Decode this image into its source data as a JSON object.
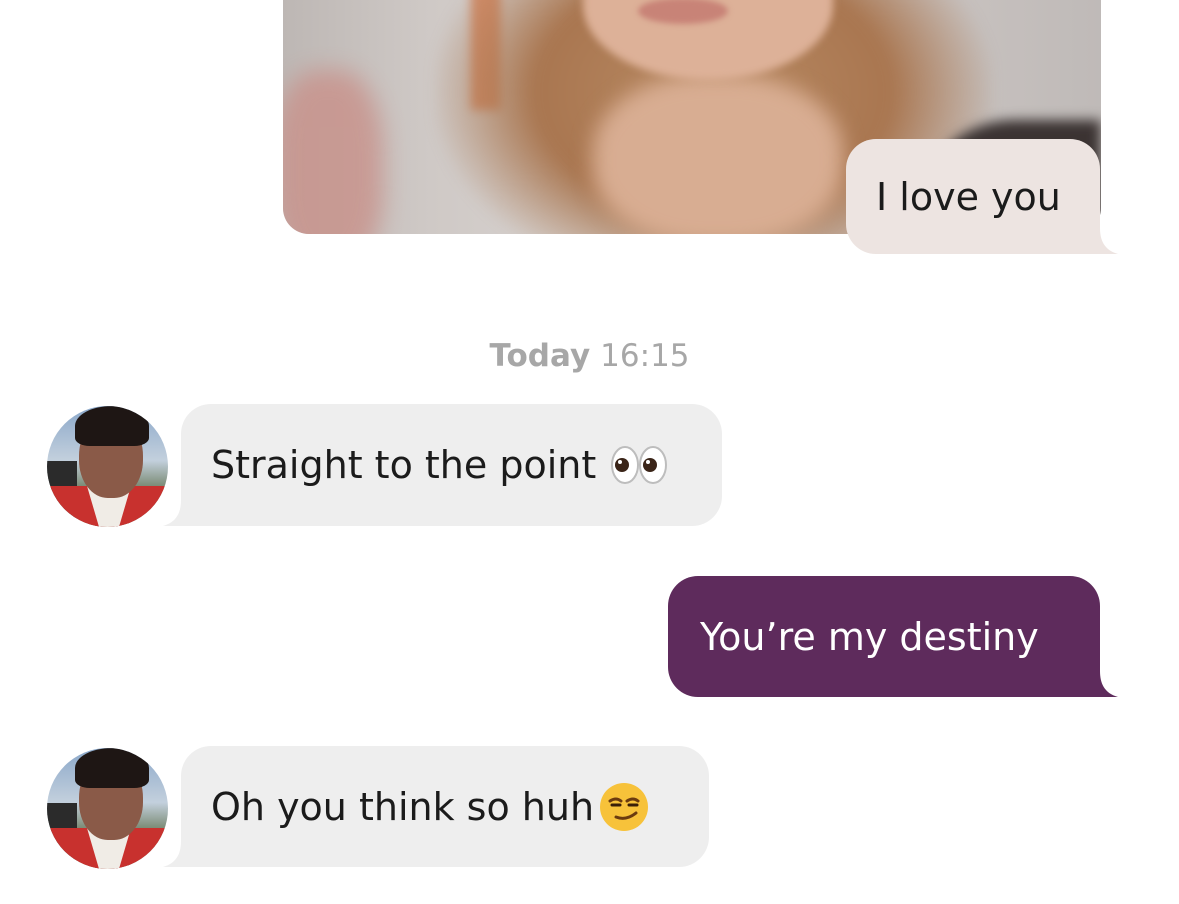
{
  "conversation": {
    "messages": [
      {
        "direction": "outgoing",
        "type": "photo-with-caption",
        "text": "I love you"
      },
      {
        "direction": "incoming",
        "type": "text",
        "text": "Straight to the point",
        "emoji": "eyes-emoji"
      },
      {
        "direction": "outgoing",
        "type": "text",
        "text": "You’re my destiny"
      },
      {
        "direction": "incoming",
        "type": "text",
        "text": "Oh you think so huh",
        "emoji": "smirking-face-emoji"
      }
    ],
    "divider": {
      "day": "Today",
      "time": "16:15"
    }
  },
  "colors": {
    "outgoing_caption_bubble": "#ede4e1",
    "outgoing_bubble": "#5e2b5c",
    "incoming_bubble": "#eeeeee",
    "timestamp": "#a7a7a7"
  }
}
